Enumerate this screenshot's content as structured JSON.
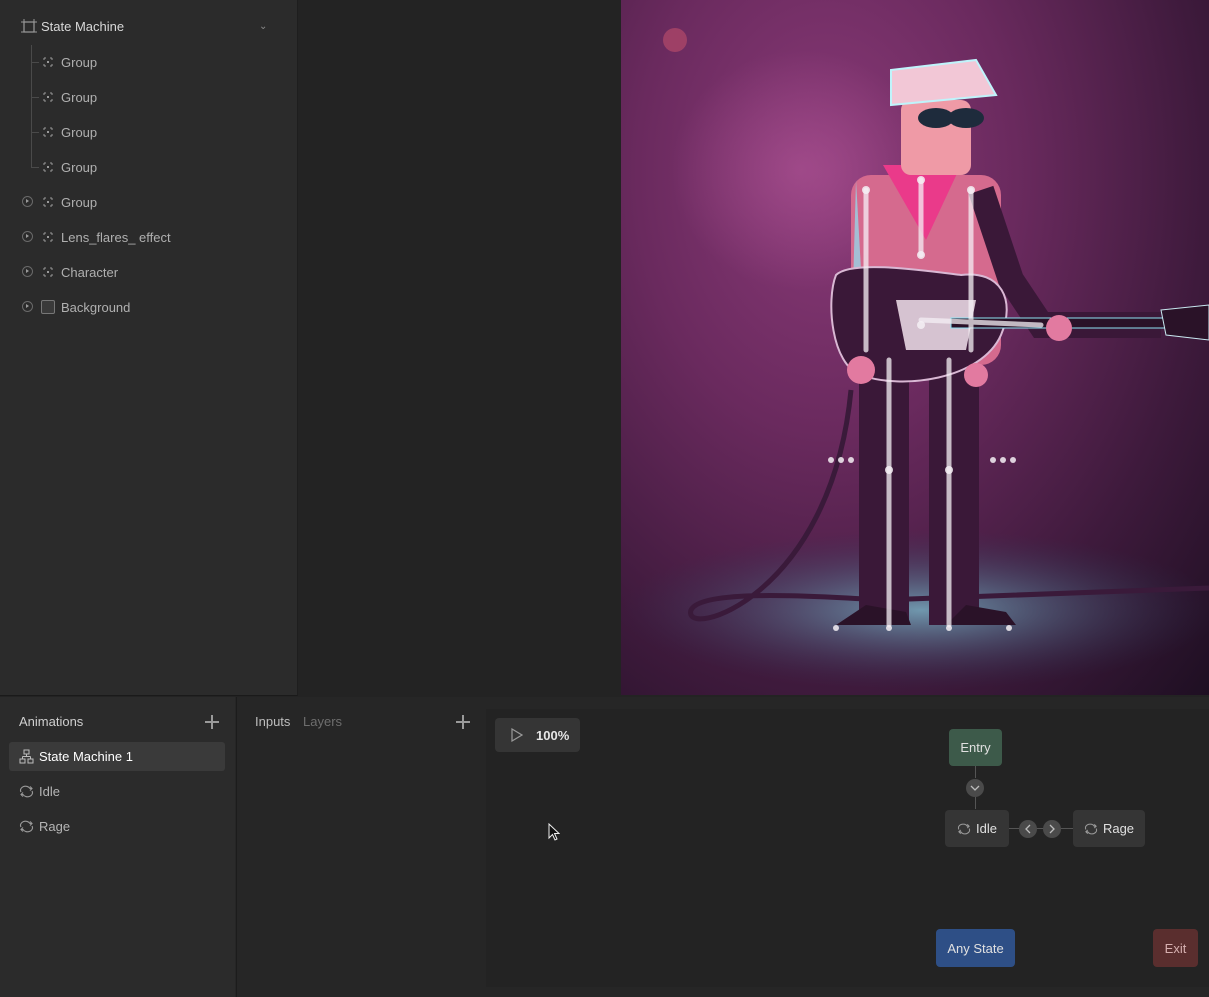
{
  "hierarchy": {
    "root_label": "State Machine",
    "items": [
      {
        "label": "Group",
        "icon": "group-icon",
        "expandable": false
      },
      {
        "label": "Group",
        "icon": "group-icon",
        "expandable": false
      },
      {
        "label": "Group",
        "icon": "group-icon",
        "expandable": false
      },
      {
        "label": "Group",
        "icon": "group-icon",
        "expandable": false
      },
      {
        "label": "Group",
        "icon": "group-icon",
        "expandable": true
      },
      {
        "label": "Lens_flares_ effect",
        "icon": "group-icon",
        "expandable": true
      },
      {
        "label": "Character",
        "icon": "group-icon",
        "expandable": true
      },
      {
        "label": "Background",
        "icon": "shape-icon",
        "expandable": true
      }
    ]
  },
  "animations": {
    "title": "Animations",
    "items": [
      {
        "label": "State Machine 1",
        "icon": "state-machine-icon",
        "selected": true
      },
      {
        "label": "Idle",
        "icon": "loop-icon",
        "selected": false
      },
      {
        "label": "Rage",
        "icon": "loop-icon",
        "selected": false
      }
    ]
  },
  "inputs_panel": {
    "tabs": [
      "Inputs",
      "Layers"
    ]
  },
  "graph": {
    "zoom": "100%",
    "nodes": {
      "entry": "Entry",
      "idle": "Idle",
      "rage": "Rage",
      "any_state": "Any State",
      "exit": "Exit"
    }
  },
  "colors": {
    "entry": "#3d5a4a",
    "any_state": "#2e4f86",
    "exit": "#5a2e2e",
    "state": "#353535"
  }
}
